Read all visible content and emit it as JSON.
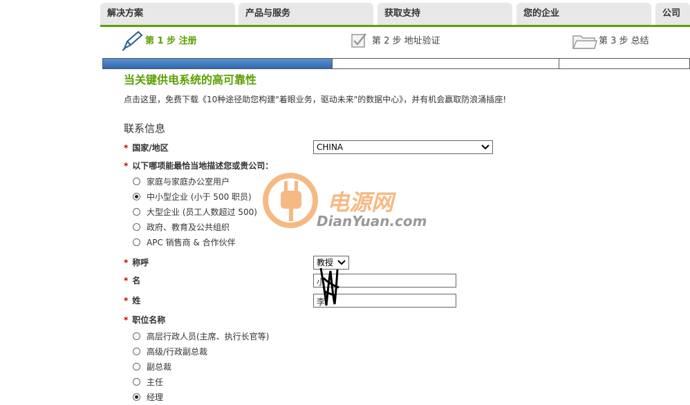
{
  "nav": {
    "tabs": [
      "解决方案",
      "产品与服务",
      "获取支持",
      "您的企业",
      "公司"
    ]
  },
  "steps": [
    {
      "label": "第 1 步 注册",
      "active": true
    },
    {
      "label": "第 2 步 地址验证",
      "active": false
    },
    {
      "label": "第 3 步 总结",
      "active": false
    }
  ],
  "progress": {
    "fraction": 0.39
  },
  "headline": "当关键供电系统的高可靠性",
  "promo": "点击这里，免费下载《10种途径助您构建\"着眼业务，驱动未来\"的数据中心》，并有机会赢取防浪涌插座!",
  "form": {
    "section_title": "联系信息",
    "required_mark": "*",
    "country": {
      "label": "国家/地区",
      "value": "CHINA"
    },
    "company_question": {
      "label": "以下哪项能最恰当地描述您或贵公司：",
      "options": [
        "家庭与家庭办公室用户",
        "中小型企业 (小于 500 职员)",
        "大型企业 (员工人数超过 500)",
        "政府、教育及公共组织",
        "APC 销售商 & 合作伙伴"
      ],
      "selected": 1
    },
    "salutation": {
      "label": "称呼",
      "value": "教授"
    },
    "first_name": {
      "label": "名",
      "value": "小"
    },
    "last_name": {
      "label": "姓",
      "value": "李"
    },
    "job_title": {
      "label": "职位名称",
      "options": [
        "高层行政人员(主席、执行长官等)",
        "高级/行政副总裁",
        "副总裁",
        "主任",
        "经理"
      ],
      "selected": 4
    }
  },
  "watermark": {
    "brand": "电源网",
    "domain": "DianYuan.com"
  },
  "colors": {
    "accent_green": "#5aa000",
    "progress_blue": "#2f6bb0",
    "required_red": "#cc0000",
    "watermark_orange": "#f5a25a"
  }
}
